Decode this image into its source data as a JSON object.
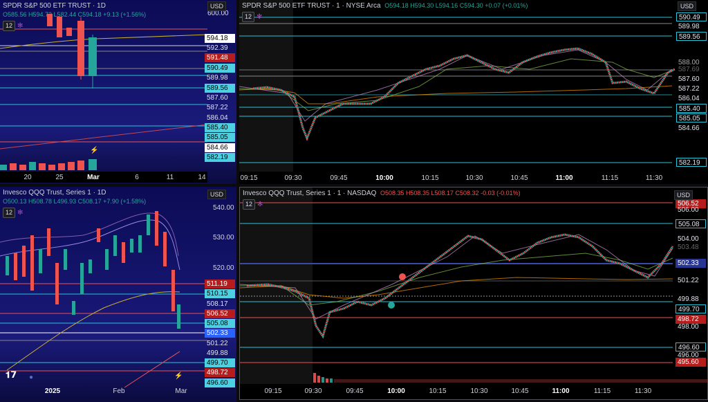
{
  "panes": {
    "spy_daily": {
      "title": "SPDR S&P 500 ETF TRUST · 1D",
      "ohlc": "O585.56 H594.72 L582.44 C594.18 +9.13 (+1.56%)",
      "interval": "12",
      "currency": "USD",
      "top_price": "600.00",
      "price_labels": [
        "594.18",
        "592.39",
        "591.48",
        "590.49",
        "589.98",
        "589.56",
        "587.60",
        "587.22",
        "586.04",
        "585.40",
        "585.05",
        "584.66",
        "582.19"
      ],
      "x_labels": [
        "20",
        "25",
        "Mar",
        "6",
        "11",
        "14"
      ]
    },
    "spy_intraday": {
      "title": "SPDR S&P 500 ETF TRUST · 1 · NYSE Arca",
      "ohlc": "O594.18 H594.30 L594.16 C594.30 +0.07 (+0.01%)",
      "interval": "12",
      "currency": "USD",
      "price_labels": [
        "590.49",
        "589.98",
        "589.56",
        "588.00",
        "587.69",
        "587.60",
        "587.22",
        "586.04",
        "585.40",
        "585.05",
        "584.66",
        "582.19"
      ],
      "x_labels": [
        "09:15",
        "09:30",
        "09:45",
        "10:00",
        "10:15",
        "10:30",
        "10:45",
        "11:00",
        "11:15",
        "11:30"
      ]
    },
    "qqq_daily": {
      "title": "Invesco QQQ Trust, Series 1 · 1D",
      "ohlc": "O500.13 H508.78 L496.93 C508.17 +7.90 (+1.58%)",
      "interval": "12",
      "currency": "USD",
      "axis_prices": [
        "540.00",
        "530.00",
        "520.00"
      ],
      "price_labels": [
        "511.19",
        "510.15",
        "508.17",
        "506.52",
        "505.08",
        "502.33",
        "501.22",
        "499.88",
        "499.70",
        "498.72",
        "496.60"
      ],
      "x_labels": [
        "2025",
        "Feb",
        "Mar"
      ]
    },
    "qqq_intraday": {
      "title": "Invesco QQQ Trust, Series 1 · 1 · NASDAQ",
      "ohlc": "O508.35 H508.35 L508.17 C508.32 -0.03 (-0.01%)",
      "interval": "12",
      "currency": "USD",
      "price_labels": [
        "506.52",
        "506.00",
        "505.08",
        "504.00",
        "503.48",
        "502.33",
        "501.22",
        "499.88",
        "499.70",
        "498.72",
        "498.00",
        "496.60",
        "496.00",
        "495.60"
      ],
      "x_labels": [
        "09:15",
        "09:30",
        "09:45",
        "10:00",
        "10:15",
        "10:30",
        "10:45",
        "11:00",
        "11:15",
        "11:30"
      ]
    }
  },
  "colors": {
    "up": "#26a69a",
    "down": "#ef5350",
    "cyan": "#26c6da",
    "bg": "#000000",
    "navy": "#0d0d5a"
  }
}
